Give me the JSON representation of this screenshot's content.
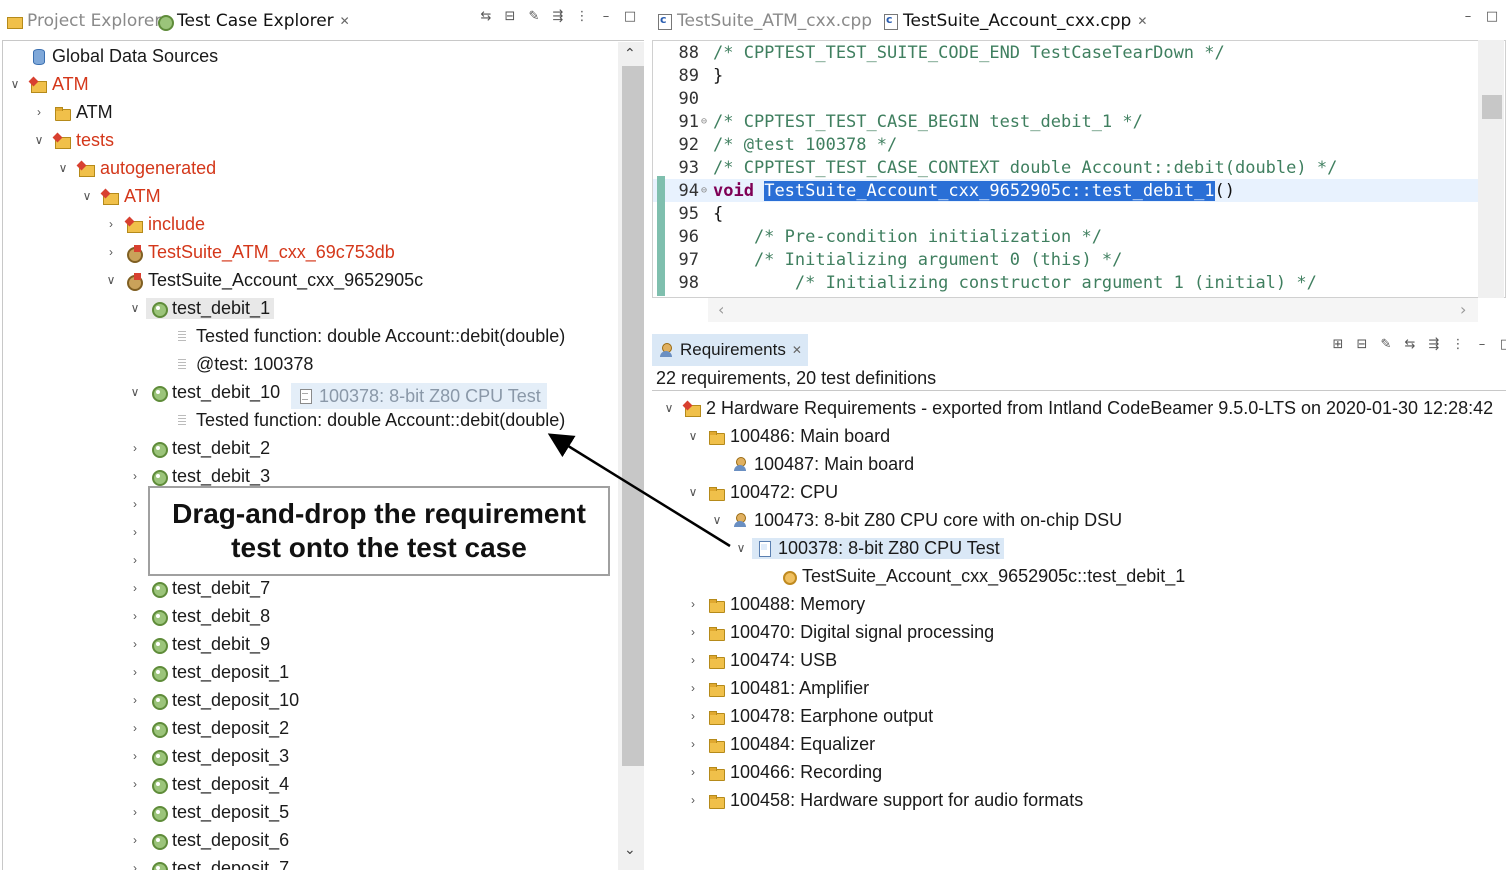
{
  "left": {
    "tabs": [
      {
        "label": "Project Explorer"
      },
      {
        "label": "Test Case Explorer"
      }
    ],
    "tree": [
      {
        "label": "Global Data Sources"
      },
      {
        "label": "ATM"
      },
      {
        "label": "ATM"
      },
      {
        "label": "tests"
      },
      {
        "label": "autogenerated"
      },
      {
        "label": "ATM"
      },
      {
        "label": "include"
      },
      {
        "label": "TestSuite_ATM_cxx_69c753db"
      },
      {
        "label": "TestSuite_Account_cxx_9652905c"
      },
      {
        "label": "test_debit_1"
      },
      {
        "label": "Tested function: double Account::debit(double)"
      },
      {
        "label": "@test: 100378"
      },
      {
        "label": "test_debit_10"
      },
      {
        "label": "Tested function: double Account::debit(double)"
      },
      {
        "label": "test_debit_2"
      },
      {
        "label": "test_debit_3"
      },
      {
        "label": "test_debit_7"
      },
      {
        "label": "test_debit_8"
      },
      {
        "label": "test_debit_9"
      },
      {
        "label": "test_deposit_1"
      },
      {
        "label": "test_deposit_10"
      },
      {
        "label": "test_deposit_2"
      },
      {
        "label": "test_deposit_3"
      },
      {
        "label": "test_deposit_4"
      },
      {
        "label": "test_deposit_5"
      },
      {
        "label": "test_deposit_6"
      },
      {
        "label": "test_deposit_7"
      }
    ],
    "drag_ghost": "100378: 8-bit Z80 CPU Test",
    "callout": {
      "line1": "Drag-and-drop the requirement",
      "line2": "test onto the test case"
    }
  },
  "editor": {
    "tabs": [
      {
        "label": "TestSuite_ATM_cxx.cpp"
      },
      {
        "label": "TestSuite_Account_cxx.cpp"
      }
    ],
    "lines": [
      {
        "num": "88",
        "text": "/* CPPTEST_TEST_SUITE_CODE_END TestCaseTearDown */"
      },
      {
        "num": "89",
        "text": "}"
      },
      {
        "num": "90",
        "text": ""
      },
      {
        "num": "91",
        "text": "/* CPPTEST_TEST_CASE_BEGIN test_debit_1 */"
      },
      {
        "num": "92",
        "text": "/* @test 100378 */"
      },
      {
        "num": "93",
        "text": "/* CPPTEST_TEST_CASE_CONTEXT double Account::debit(double) */"
      },
      {
        "num": "94",
        "keyword": "void",
        "highlight": "TestSuite_Account_cxx_9652905c::test_debit_1",
        "rest": "()"
      },
      {
        "num": "95",
        "text": "{"
      },
      {
        "num": "96",
        "text": "    /* Pre-condition initialization */"
      },
      {
        "num": "97",
        "text": "    /* Initializing argument 0 (this) */"
      },
      {
        "num": "98",
        "text": "        /* Initializing constructor argument 1 (initial) */"
      }
    ]
  },
  "requirements": {
    "tab_label": "Requirements",
    "summary": "22 requirements, 20 test definitions",
    "tree": [
      {
        "label": "2 Hardware Requirements - exported from Intland CodeBeamer 9.5.0-LTS on 2020-01-30 12:28:42"
      },
      {
        "label": "100486: Main board"
      },
      {
        "label": "100487: Main board"
      },
      {
        "label": "100472: CPU"
      },
      {
        "label": "100473: 8-bit Z80 CPU core with on-chip DSU"
      },
      {
        "label": "100378: 8-bit Z80 CPU Test"
      },
      {
        "label": "TestSuite_Account_cxx_9652905c::test_debit_1"
      },
      {
        "label": "100488: Memory"
      },
      {
        "label": "100470: Digital signal processing"
      },
      {
        "label": "100474: USB"
      },
      {
        "label": "100481: Amplifier"
      },
      {
        "label": "100478: Earphone output"
      },
      {
        "label": "100484: Equalizer"
      },
      {
        "label": "100466: Recording"
      },
      {
        "label": "100458: Hardware support for audio formats"
      }
    ]
  },
  "colors": {
    "accent_selection": "#dae8f6",
    "editor_highlight": "#2a6fd6",
    "red_label": "#d4371a"
  }
}
